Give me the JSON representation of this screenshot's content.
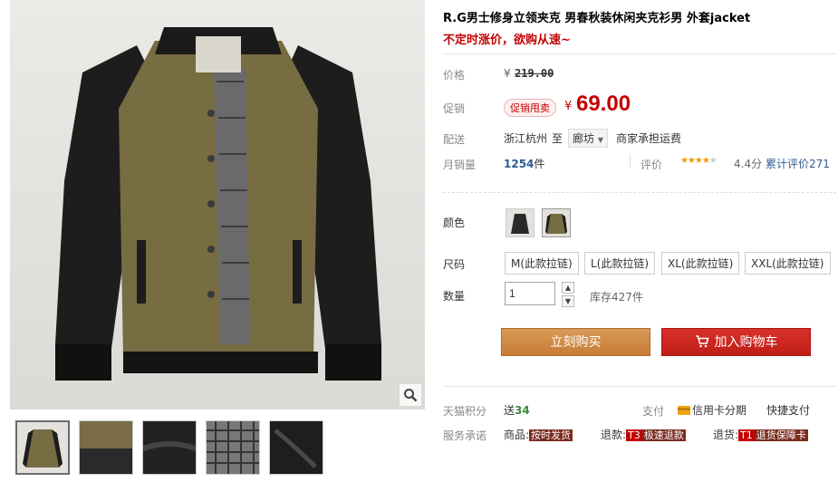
{
  "product": {
    "title": "R.G男士修身立领夹克 男春秋装休闲夹克衫男 外套jacket",
    "promo": "不定时涨价，欲购从速~"
  },
  "price": {
    "label": "价格",
    "currency": "¥",
    "original": "219.00"
  },
  "promotion": {
    "label": "促销",
    "badge": "促销甩卖",
    "currency": "¥",
    "price": "69.00"
  },
  "shipping": {
    "label": "配送",
    "from": "浙江杭州",
    "to_word": "至",
    "destination": "廊坊",
    "fee": "商家承担运费"
  },
  "sales": {
    "label": "月销量",
    "count": "1254",
    "unit": "件",
    "rating_label": "评价",
    "score": "4.4分",
    "review_text": "累计评价",
    "review_count": "271"
  },
  "sku": {
    "color_label": "颜色",
    "size_label": "尺码",
    "sizes": [
      "M(此款拉链)",
      "L(此款拉链)",
      "XL(此款拉链)",
      "XXL(此款拉链)"
    ],
    "qty_label": "数量",
    "qty_value": "1",
    "stock": "库存427件"
  },
  "buttons": {
    "buy": "立刻购买",
    "cart": "加入购物车"
  },
  "points": {
    "label": "天猫积分",
    "give_word": "送",
    "amount": "34",
    "pay_label": "支付",
    "credit": "信用卡分期",
    "quick": "快捷支付"
  },
  "service": {
    "label": "服务承诺",
    "item1_prefix": "商品:",
    "item1_tag": "按时发货",
    "item2_prefix": "退款:",
    "item2_tag1": "T3",
    "item2_tag2": "极速退款",
    "item3_prefix": "退货:",
    "item3_tag1": "T1",
    "item3_tag2": "退货保障卡"
  },
  "colors": {
    "accent_red": "#c40000",
    "buy_orange": "#c97b34",
    "cart_red": "#c01d17",
    "link_blue": "#2f5b8f",
    "star_orange": "#f29b00"
  },
  "icons": [
    "zoom-icon",
    "cart-icon",
    "credit-card-icon",
    "star-icon",
    "chevron-up-icon",
    "chevron-down-icon",
    "dropdown-arrow-icon"
  ]
}
